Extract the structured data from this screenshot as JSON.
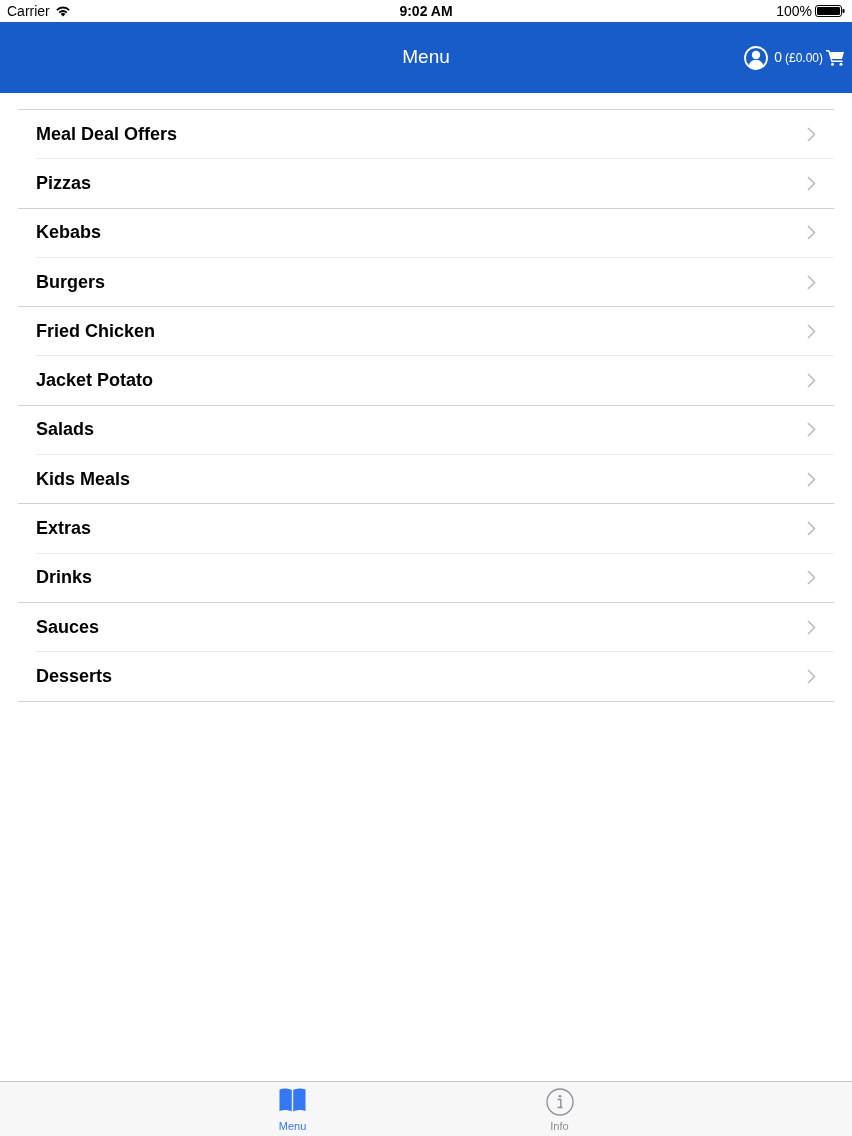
{
  "status_bar": {
    "carrier": "Carrier",
    "time": "9:02 AM",
    "battery": "100%"
  },
  "nav_bar": {
    "title": "Menu",
    "cart": {
      "count": "0",
      "total": "(£0.00)"
    }
  },
  "categories": [
    {
      "label": "Meal Deal Offers"
    },
    {
      "label": "Pizzas"
    },
    {
      "label": "Kebabs"
    },
    {
      "label": "Burgers"
    },
    {
      "label": "Fried Chicken"
    },
    {
      "label": "Jacket Potato"
    },
    {
      "label": "Salads"
    },
    {
      "label": "Kids Meals"
    },
    {
      "label": "Extras"
    },
    {
      "label": "Drinks"
    },
    {
      "label": "Sauces"
    },
    {
      "label": "Desserts"
    }
  ],
  "tab_bar": [
    {
      "kind": "book",
      "label": "Menu",
      "selected": true
    },
    {
      "kind": "info",
      "label": "Info",
      "selected": false
    }
  ]
}
